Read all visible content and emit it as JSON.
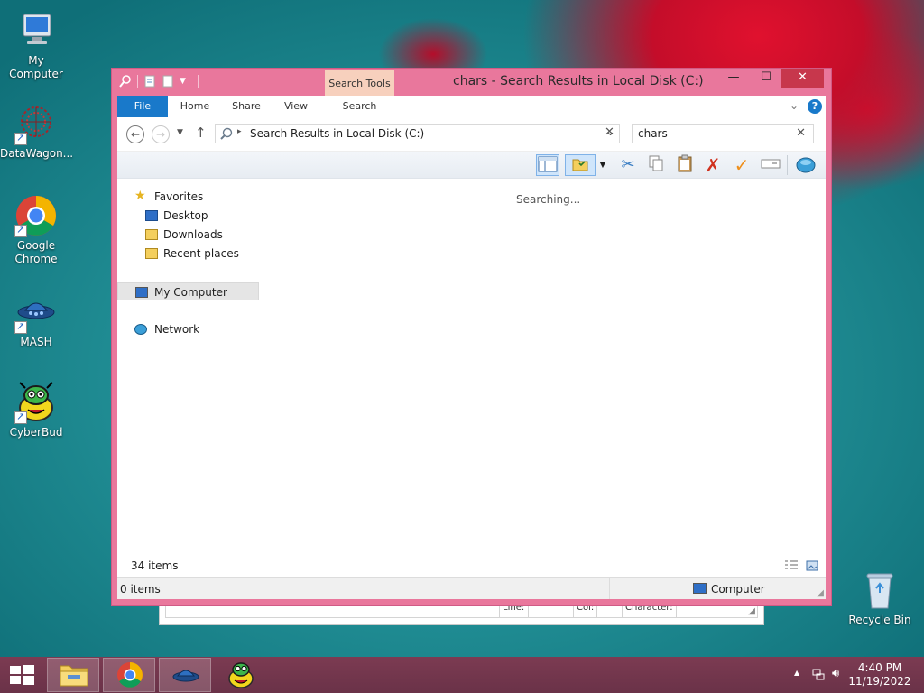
{
  "desktop": {
    "icons": [
      {
        "label": "My Computer",
        "icon": "computer-icon"
      },
      {
        "label": "DataWagon...",
        "icon": "datawagon-icon"
      },
      {
        "label": "Google Chrome",
        "icon": "chrome-icon"
      },
      {
        "label": "MASH",
        "icon": "mash-icon"
      },
      {
        "label": "CyberBud",
        "icon": "cyberbud-icon"
      },
      {
        "label": "Recycle Bin",
        "icon": "recycle-bin-icon"
      }
    ]
  },
  "background_window": {
    "status_cells": [
      "Line:",
      "",
      "Col:",
      "",
      "Character:"
    ]
  },
  "explorer": {
    "title": "chars - Search Results in Local Disk (C:)",
    "context_tab": "Search Tools",
    "ribbon_tabs": [
      "File",
      "Home",
      "Share",
      "View",
      "Search"
    ],
    "address": "Search Results in Local Disk (C:)",
    "search_value": "chars",
    "nav": {
      "favorites": "Favorites",
      "desktop": "Desktop",
      "downloads": "Downloads",
      "recent": "Recent places",
      "computer": "My Computer",
      "network": "Network"
    },
    "status_message": "Searching...",
    "item_count": "34 items",
    "selected_count": "0 items",
    "location": "Computer"
  },
  "taskbar": {
    "items": [
      "start-icon",
      "file-explorer-icon",
      "chrome-icon",
      "mash-icon",
      "cyberbud-icon"
    ],
    "time": "4:40 PM",
    "date": "11/19/2022"
  },
  "colors": {
    "window_frame": "#e9779c",
    "file_tab": "#1979ca",
    "context_tab": "#f7d0bd",
    "taskbar": "#6a3248"
  }
}
